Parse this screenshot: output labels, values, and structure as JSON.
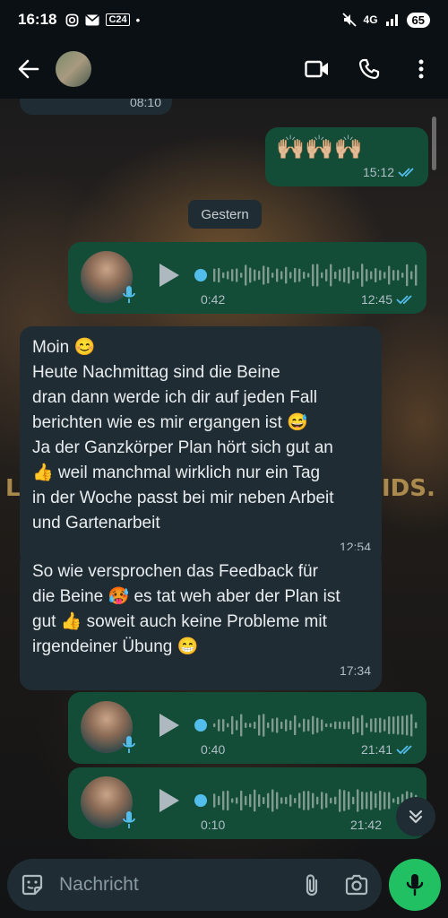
{
  "status_bar": {
    "time": "16:18",
    "carrier": "C24",
    "network": "4G",
    "battery": "65"
  },
  "header": {
    "back_icon": "arrow-left-icon",
    "video_icon": "video-camera-icon",
    "call_icon": "phone-icon",
    "menu_icon": "more-vert-icon"
  },
  "messages": {
    "top_partial_time": "08:10",
    "m1": {
      "emoji": "🙌🏼🙌🏼🙌🏼",
      "time": "15:12"
    },
    "date_chip": "Gestern",
    "voice1": {
      "duration": "0:42",
      "time": "12:45"
    },
    "m3": {
      "lines": [
        "Moin 😊",
        "Heute Nachmittag sind die Beine",
        "dran dann werde ich dir auf jeden Fall",
        "berichten wie es mir ergangen ist 😅",
        "Ja der Ganzkörper Plan hört sich gut an",
        "👍 weil manchmal wirklich nur ein Tag",
        "in der Woche passt bei mir neben Arbeit",
        "und Gartenarbeit"
      ],
      "time": "12:54"
    },
    "m4": {
      "lines": [
        "So wie versprochen das Feedback für",
        "die Beine 🥵 es tat weh aber der Plan ist",
        "gut 👍 soweit auch keine Probleme mit",
        "irgendeiner Übung 😁"
      ],
      "time": "17:34"
    },
    "voice2": {
      "duration": "0:40",
      "time": "21:41"
    },
    "voice3": {
      "duration": "0:10",
      "time": "21:42"
    }
  },
  "wallpaper": {
    "left_text": "L",
    "right_text": "IDS."
  },
  "input": {
    "placeholder": "Nachricht"
  },
  "colors": {
    "outgoing": "#134d37",
    "incoming": "#1f2c33",
    "accent": "#21c063",
    "read_ticks": "#53bdeb"
  }
}
